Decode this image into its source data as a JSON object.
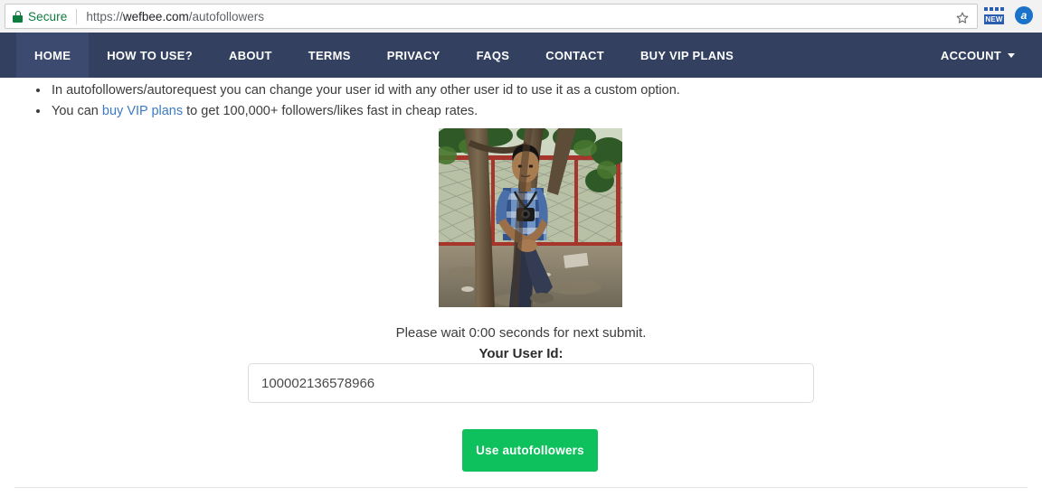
{
  "browser": {
    "security_label": "Secure",
    "url": {
      "scheme": "https://",
      "host": "wefbee.com",
      "path": "/autofollowers"
    },
    "star_icon": "star-icon",
    "new_badge_label": "NEW",
    "avatar_initial": "a"
  },
  "navbar": {
    "items": [
      {
        "label": "HOME",
        "active": true
      },
      {
        "label": "HOW TO USE?",
        "active": false
      },
      {
        "label": "ABOUT",
        "active": false
      },
      {
        "label": "TERMS",
        "active": false
      },
      {
        "label": "PRIVACY",
        "active": false
      },
      {
        "label": "FAQS",
        "active": false
      },
      {
        "label": "CONTACT",
        "active": false
      },
      {
        "label": "BUY VIP PLANS",
        "active": false
      }
    ],
    "account_label": "ACCOUNT",
    "background_color": "#334060",
    "active_background_color": "#3b4a6e"
  },
  "content": {
    "notes": [
      {
        "before": "In autofollowers/autorequest you can change your user id with any other user id to use it as a custom option.",
        "link": "",
        "after": ""
      },
      {
        "before": "You can ",
        "link": "buy VIP plans",
        "after": " to get 100,000+ followers/likes fast in cheap rates."
      }
    ],
    "profile_photo_alt": "profile-photo",
    "wait_message": "Please wait 0:00 seconds for next submit.",
    "user_id_label": "Your User Id:",
    "user_id_value": "100002136578966",
    "user_id_placeholder": "Enter your user id",
    "submit_label": "Use autofollowers",
    "submit_color": "#0fc15d",
    "link_color": "#3b7bc4"
  }
}
